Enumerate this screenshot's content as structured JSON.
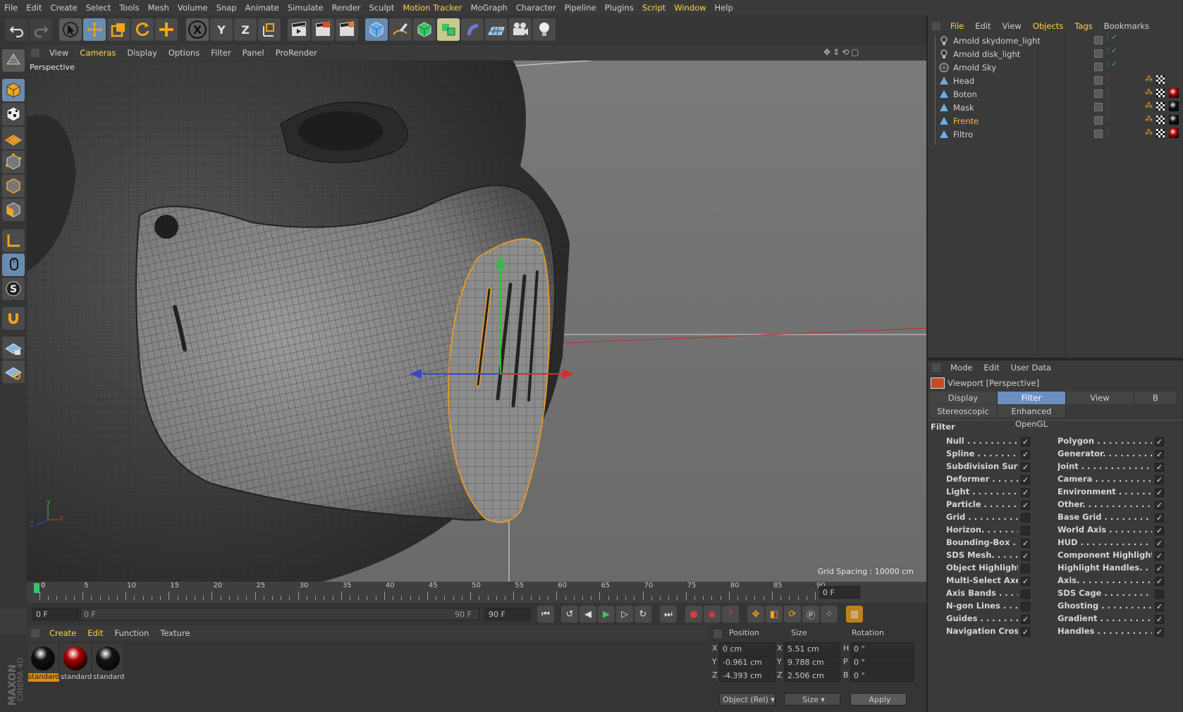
{
  "menubar": [
    "File",
    "Edit",
    "Create",
    "Select",
    "Tools",
    "Mesh",
    "Volume",
    "Snap",
    "Animate",
    "Simulate",
    "Render",
    "Sculpt",
    "Motion Tracker",
    "MoGraph",
    "Character",
    "Pipeline",
    "Plugins",
    "Script",
    "Window",
    "Help"
  ],
  "menubar_highlight": [
    "Motion Tracker",
    "Script",
    "Window"
  ],
  "toolbar": {
    "axis_x": "X",
    "axis_y": "Y",
    "axis_z": "Z"
  },
  "viewport": {
    "menu": [
      "View",
      "Cameras",
      "Display",
      "Options",
      "Filter",
      "Panel",
      "ProRender"
    ],
    "menu_highlight": "Cameras",
    "label": "Perspective",
    "grid_spacing": "Grid Spacing : 10000 cm",
    "axis_y": "Y",
    "axis_x": "X",
    "axis_z": "Z"
  },
  "timeline": {
    "ticks": [
      "0",
      "5",
      "10",
      "15",
      "20",
      "25",
      "30",
      "35",
      "40",
      "45",
      "50",
      "55",
      "60",
      "65",
      "70",
      "75",
      "80",
      "85",
      "90"
    ],
    "current_frame": "0 F",
    "start_field": "0 F",
    "range_start": "0 F",
    "range_end": "90 F",
    "end_field": "90 F"
  },
  "material_manager": {
    "menu": [
      "Create",
      "Edit",
      "Function",
      "Texture"
    ],
    "materials": [
      {
        "name": "standard",
        "color": "#111111",
        "selected": true
      },
      {
        "name": "standard",
        "color": "#b00000",
        "selected": false
      },
      {
        "name": "standard",
        "color": "#151515",
        "selected": false
      }
    ]
  },
  "coordinates": {
    "headers": [
      "Position",
      "Size",
      "Rotation"
    ],
    "rows": [
      {
        "axis": "X",
        "pos": "0 cm",
        "saxis": "X",
        "size": "5.51 cm",
        "raxis": "H",
        "rot": "0 °"
      },
      {
        "axis": "Y",
        "pos": "-0.961 cm",
        "saxis": "Y",
        "size": "9.788 cm",
        "raxis": "P",
        "rot": "0 °"
      },
      {
        "axis": "Z",
        "pos": "-4.393 cm",
        "saxis": "Z",
        "size": "2.506 cm",
        "raxis": "B",
        "rot": "0 °"
      }
    ],
    "mode_dropdown": "Object (Rel)",
    "size_dropdown": "Size",
    "apply_label": "Apply"
  },
  "object_manager": {
    "menu": [
      "File",
      "Edit",
      "View",
      "Objects",
      "Tags",
      "Bookmarks"
    ],
    "menu_highlight": [
      "File",
      "Objects",
      "Tags"
    ],
    "objects": [
      {
        "name": "Arnold skydome_light",
        "icon": "light-bulb-icon",
        "highlight": false
      },
      {
        "name": "Arnold disk_light",
        "icon": "light-bulb-icon",
        "highlight": false
      },
      {
        "name": "Arnold Sky",
        "icon": "sky-icon",
        "highlight": false
      },
      {
        "name": "Head",
        "icon": "polygon-object-icon",
        "highlight": false
      },
      {
        "name": "Boton",
        "icon": "polygon-object-icon",
        "highlight": false
      },
      {
        "name": "Mask",
        "icon": "polygon-object-icon",
        "highlight": false
      },
      {
        "name": "Frente",
        "icon": "polygon-object-icon",
        "highlight": true
      },
      {
        "name": "Filtro",
        "icon": "polygon-object-icon",
        "highlight": false
      }
    ]
  },
  "attribute_manager": {
    "menu": [
      "Mode",
      "Edit",
      "User Data"
    ],
    "title": "Viewport [Perspective]",
    "tabs_row1": [
      "Display",
      "Filter",
      "View",
      "B"
    ],
    "tabs_row1_active": "Filter",
    "tabs_row2": [
      "Stereoscopic",
      "Enhanced OpenGL"
    ],
    "section": "Filter",
    "filters_left": [
      {
        "label": "Null . . . . . . . . . . . . . . .",
        "checked": true
      },
      {
        "label": "Spline . . . . . . . . . . . . .",
        "checked": true
      },
      {
        "label": "Subdivision Surface",
        "checked": true
      },
      {
        "label": "Deformer . . . . . . . . . . .",
        "checked": true
      },
      {
        "label": "Light . . . . . . . . . . . . . . .",
        "checked": true
      },
      {
        "label": "Particle . . . . . . . . . . . .",
        "checked": true
      },
      {
        "label": "Grid . . . . . . . . . . . . . . . .",
        "checked": false
      },
      {
        "label": "Horizon. . . . . . . . . . . . .",
        "checked": false
      },
      {
        "label": "Bounding-Box . . . . . . . .",
        "checked": true
      },
      {
        "label": "SDS Mesh. . . . . . . . . . .",
        "checked": true
      },
      {
        "label": "Object Highlighting",
        "checked": false
      },
      {
        "label": "Multi-Select Axes . .",
        "checked": true
      },
      {
        "label": "Axis Bands . . . . . . . . . .",
        "checked": false
      },
      {
        "label": "N-gon Lines . . . . . . . . .",
        "checked": false
      },
      {
        "label": "Guides . . . . . . . . . . . . .",
        "checked": true
      },
      {
        "label": "Navigation Cross. . .",
        "checked": true
      }
    ],
    "filters_right": [
      {
        "label": "Polygon . . . . . . . . . . . . . . . .",
        "checked": true
      },
      {
        "label": "Generator. . . . . . . . . . . . . .",
        "checked": true
      },
      {
        "label": "Joint . . . . . . . . . . . . . . . . . . .",
        "checked": true
      },
      {
        "label": "Camera . . . . . . . . . . . . . . . . .",
        "checked": true
      },
      {
        "label": "Environment . . . . . . . . . . .",
        "checked": true
      },
      {
        "label": "Other. . . . . . . . . . . . . . . . . . .",
        "checked": true
      },
      {
        "label": "Base Grid . . . . . . . . . . . . . .",
        "checked": true
      },
      {
        "label": "World Axis . . . . . . . . . . . . .",
        "checked": true
      },
      {
        "label": "HUD . . . . . . . . . . . . . . . . . . . .",
        "checked": true
      },
      {
        "label": "Component Highlighting",
        "checked": true
      },
      {
        "label": "Highlight Handles. . . . . . .",
        "checked": true
      },
      {
        "label": "Axis. . . . . . . . . . . . . . . . . . . .",
        "checked": true
      },
      {
        "label": "SDS Cage . . . . . . . . . . . . . .",
        "checked": false
      },
      {
        "label": "Ghosting . . . . . . . . . . . . . . . .",
        "checked": true
      },
      {
        "label": "Gradient . . . . . . . . . . . . . . . .",
        "checked": true
      },
      {
        "label": "Handles . . . . . . . . . . . . . . . . .",
        "checked": true
      }
    ]
  },
  "brand": {
    "line1": "MAXON",
    "line2": "CINEMA 4D"
  },
  "colors": {
    "accent": "#ffd24a",
    "selection": "#e08a18",
    "active_tab": "#6c8fc0"
  }
}
